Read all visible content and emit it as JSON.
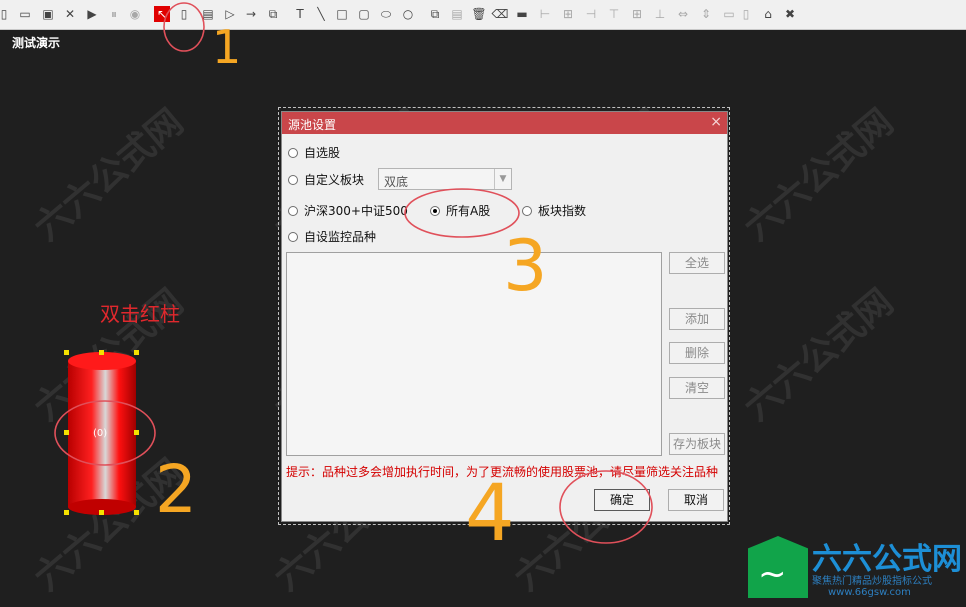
{
  "toolbar": {
    "icons": [
      "new-doc-icon",
      "open-folder-icon",
      "save-icon",
      "close-x-icon",
      "play-icon",
      "pause-icon",
      "stop-icon",
      "select-arrow-icon",
      "cylinder-tool-icon",
      "table-tool-icon",
      "triangle-play-icon",
      "arrow-right-icon",
      "copy-frame-icon",
      "text-tool-icon",
      "line-tool-icon",
      "rectangle-tool-icon",
      "rounded-rect-tool-icon",
      "ellipse-tool-icon",
      "circle-tool-icon",
      "copy-icon",
      "paste-icon",
      "delete-icon",
      "eraser-icon",
      "fill-icon",
      "align-left-icon",
      "align-center-icon",
      "align-right-icon",
      "align-top-icon",
      "align-middle-icon",
      "align-bottom-icon",
      "same-width-icon",
      "same-height-icon",
      "same-size-icon",
      "home-icon",
      "exit-x-icon"
    ]
  },
  "canvas": {
    "title": "测试演示",
    "hint_text": "双击红柱",
    "cylinder_label": "(0)"
  },
  "dialog": {
    "title": "源池设置",
    "close_symbol": "×",
    "options": {
      "self_selected": "自选股",
      "custom_block": "自定义板块",
      "combo_value": "双底",
      "hs300_zz500": "沪深300+中证500",
      "all_a_shares": "所有A股",
      "block_index": "板块指数",
      "self_monitor": "自设监控品种"
    },
    "selected_option": "all_a_shares",
    "buttons": {
      "select_all": "全选",
      "add": "添加",
      "delete": "删除",
      "clear": "清空",
      "save_block": "存为板块",
      "ok": "确定",
      "cancel": "取消"
    },
    "tip": "提示：品种过多会增加执行时间，为了更流畅的使用股票池，请尽量筛选关注品种"
  },
  "annotations": {
    "numbers": [
      "1",
      "2",
      "3",
      "4"
    ],
    "color": "#f5a623",
    "circle_color": "#e0505a"
  },
  "watermark": {
    "brand": "六六公式网",
    "slogan": "聚焦热门精品炒股指标公式",
    "url": "www.66gsw.com"
  },
  "colors": {
    "title_bar": "#c9464a",
    "tip_text": "#d40000",
    "cylinder": "#ee0000"
  }
}
